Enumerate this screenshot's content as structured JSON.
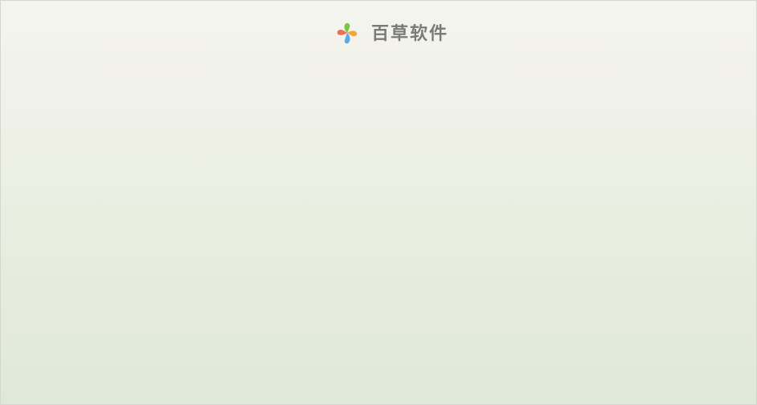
{
  "brand": {
    "name": "百草软件",
    "logo_icon": "pinwheel-logo-icon",
    "logo_colors": {
      "green": "#7cc644",
      "orange": "#f5a43a",
      "blue": "#5fa8e6",
      "red": "#ec6f5a"
    }
  },
  "colors": {
    "background_top": "#f5f4ef",
    "background_bottom": "#dfe9d7",
    "brand_text": "#7a7a7a"
  }
}
